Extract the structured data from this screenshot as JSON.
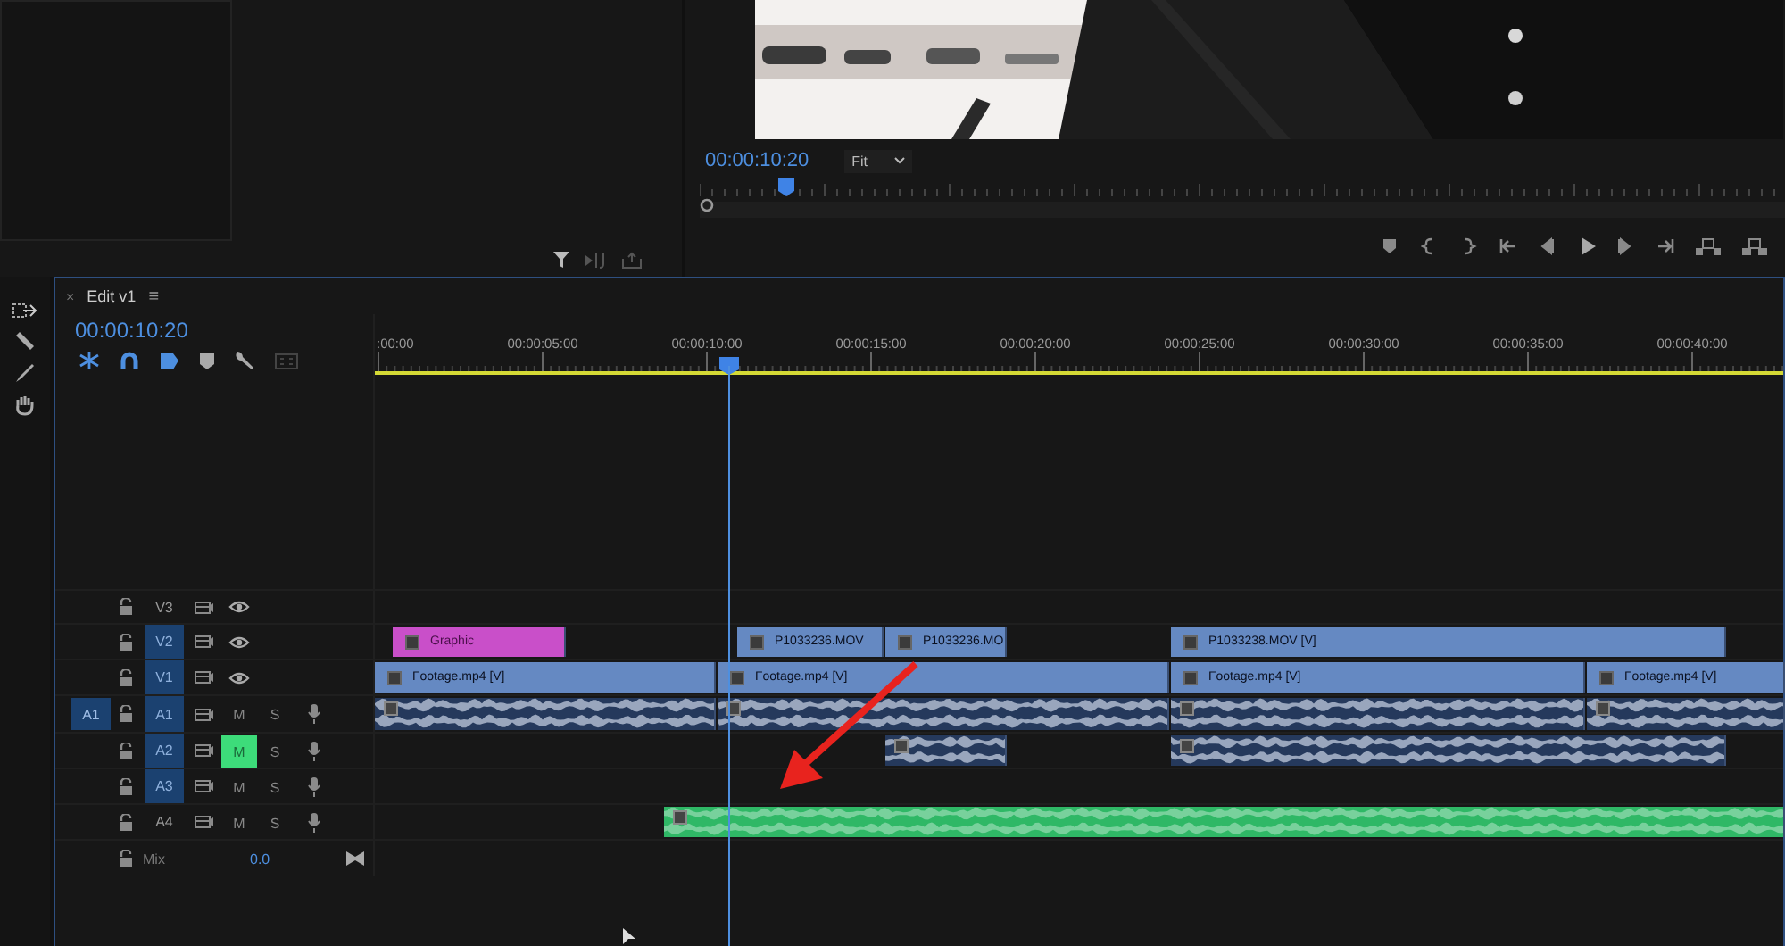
{
  "program_monitor": {
    "timecode": "00:00:10:20",
    "zoom": "Fit",
    "level": 0.073
  },
  "timeline": {
    "tab": {
      "close": "×",
      "title": "Edit v1",
      "menu": "≡"
    },
    "timecode": "00:00:10:20",
    "ruler": [
      ":00:00",
      "00:00:05:00",
      "00:00:10:00",
      "00:00:15:00",
      "00:00:20:00",
      "00:00:25:00",
      "00:00:30:00",
      "00:00:35:00",
      "00:00:40:00"
    ],
    "tracks": [
      {
        "kind": "video",
        "name": "V3",
        "targeted": false
      },
      {
        "kind": "video",
        "name": "V2",
        "targeted": true,
        "clips": [
          {
            "kind": "graphic",
            "label": "Graphic",
            "color": "#c94fc9"
          },
          {
            "kind": "video",
            "label": "P1033236.MOV",
            "color": "#6589c2"
          },
          {
            "kind": "video",
            "label": "P1033236.MO",
            "color": "#6589c2"
          },
          {
            "kind": "video",
            "label": "P1033238.MOV [V]",
            "color": "#6589c2"
          }
        ]
      },
      {
        "kind": "video",
        "name": "V1",
        "targeted": true,
        "clips": [
          {
            "kind": "video",
            "label": "Footage.mp4 [V]",
            "color": "#6589c2"
          },
          {
            "kind": "video",
            "label": "Footage.mp4 [V]",
            "color": "#6589c2"
          },
          {
            "kind": "video",
            "label": "Footage.mp4 [V]",
            "color": "#6589c2"
          },
          {
            "kind": "video",
            "label": "Footage.mp4 [V]",
            "color": "#6589c2"
          }
        ]
      },
      {
        "kind": "audio",
        "name": "A1",
        "source": "A1",
        "targeted": true,
        "mute": "M",
        "solo": "S",
        "muted": false,
        "clips": [
          {
            "kind": "audio",
            "color": "#25395c"
          },
          {
            "kind": "audio",
            "color": "#25395c"
          },
          {
            "kind": "audio",
            "color": "#25395c"
          },
          {
            "kind": "audio",
            "color": "#25395c"
          }
        ]
      },
      {
        "kind": "audio",
        "name": "A2",
        "targeted": true,
        "mute": "M",
        "solo": "S",
        "muted": true,
        "clips": [
          {
            "kind": "audio",
            "color": "#25395c"
          },
          {
            "kind": "audio",
            "color": "#25395c"
          }
        ]
      },
      {
        "kind": "audio",
        "name": "A3",
        "targeted": true,
        "mute": "M",
        "solo": "S",
        "muted": false
      },
      {
        "kind": "audio",
        "name": "A4",
        "targeted": false,
        "mute": "M",
        "solo": "S",
        "muted": false,
        "clips": [
          {
            "kind": "audio",
            "color": "#2fb866"
          }
        ]
      },
      {
        "kind": "mix",
        "name": "Mix",
        "value": "0.0"
      }
    ]
  }
}
